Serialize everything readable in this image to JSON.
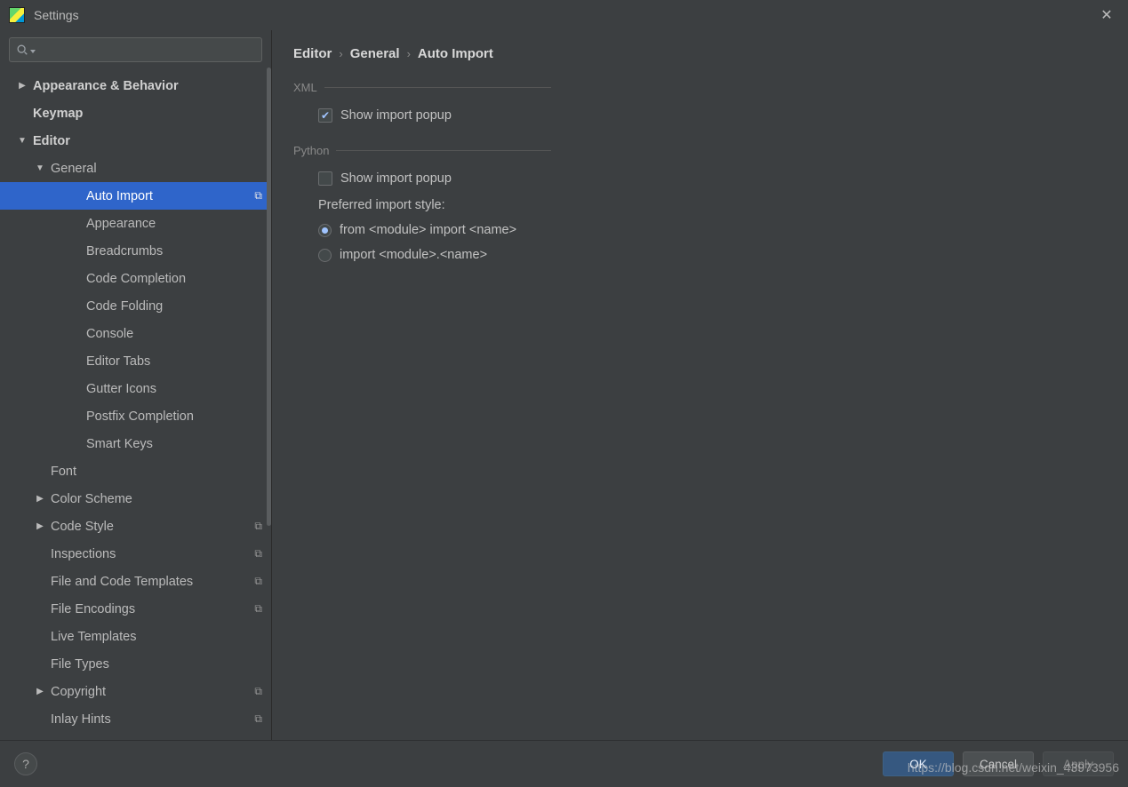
{
  "window": {
    "title": "Settings"
  },
  "search": {
    "placeholder": ""
  },
  "sidebar": {
    "items": [
      {
        "label": "Appearance & Behavior",
        "level": 0,
        "bold": true,
        "arrow": "right"
      },
      {
        "label": "Keymap",
        "level": 0,
        "bold": true,
        "arrow": "none"
      },
      {
        "label": "Editor",
        "level": 0,
        "bold": true,
        "arrow": "down"
      },
      {
        "label": "General",
        "level": 1,
        "bold": false,
        "arrow": "down"
      },
      {
        "label": "Auto Import",
        "level": 2,
        "bold": false,
        "arrow": "none",
        "selected": true,
        "proj": true
      },
      {
        "label": "Appearance",
        "level": 2,
        "bold": false,
        "arrow": "none"
      },
      {
        "label": "Breadcrumbs",
        "level": 2,
        "bold": false,
        "arrow": "none"
      },
      {
        "label": "Code Completion",
        "level": 2,
        "bold": false,
        "arrow": "none"
      },
      {
        "label": "Code Folding",
        "level": 2,
        "bold": false,
        "arrow": "none"
      },
      {
        "label": "Console",
        "level": 2,
        "bold": false,
        "arrow": "none"
      },
      {
        "label": "Editor Tabs",
        "level": 2,
        "bold": false,
        "arrow": "none"
      },
      {
        "label": "Gutter Icons",
        "level": 2,
        "bold": false,
        "arrow": "none"
      },
      {
        "label": "Postfix Completion",
        "level": 2,
        "bold": false,
        "arrow": "none"
      },
      {
        "label": "Smart Keys",
        "level": 2,
        "bold": false,
        "arrow": "none"
      },
      {
        "label": "Font",
        "level": 1,
        "bold": false,
        "arrow": "none"
      },
      {
        "label": "Color Scheme",
        "level": 1,
        "bold": false,
        "arrow": "right"
      },
      {
        "label": "Code Style",
        "level": 1,
        "bold": false,
        "arrow": "right",
        "proj": true
      },
      {
        "label": "Inspections",
        "level": 1,
        "bold": false,
        "arrow": "none",
        "proj": true
      },
      {
        "label": "File and Code Templates",
        "level": 1,
        "bold": false,
        "arrow": "none",
        "proj": true
      },
      {
        "label": "File Encodings",
        "level": 1,
        "bold": false,
        "arrow": "none",
        "proj": true
      },
      {
        "label": "Live Templates",
        "level": 1,
        "bold": false,
        "arrow": "none"
      },
      {
        "label": "File Types",
        "level": 1,
        "bold": false,
        "arrow": "none"
      },
      {
        "label": "Copyright",
        "level": 1,
        "bold": false,
        "arrow": "right",
        "proj": true
      },
      {
        "label": "Inlay Hints",
        "level": 1,
        "bold": false,
        "arrow": "none",
        "proj": true
      }
    ]
  },
  "breadcrumb": {
    "a": "Editor",
    "b": "General",
    "c": "Auto Import"
  },
  "content": {
    "section_xml": "XML",
    "xml_show_popup": "Show import popup",
    "section_python": "Python",
    "py_show_popup": "Show import popup",
    "py_pref_style": "Preferred import style:",
    "py_opt1": "from <module> import <name>",
    "py_opt2": "import <module>.<name>"
  },
  "buttons": {
    "ok": "OK",
    "cancel": "Cancel",
    "apply": "Apply"
  },
  "watermark": "https://blog.csdn.net/weixin_43973956"
}
